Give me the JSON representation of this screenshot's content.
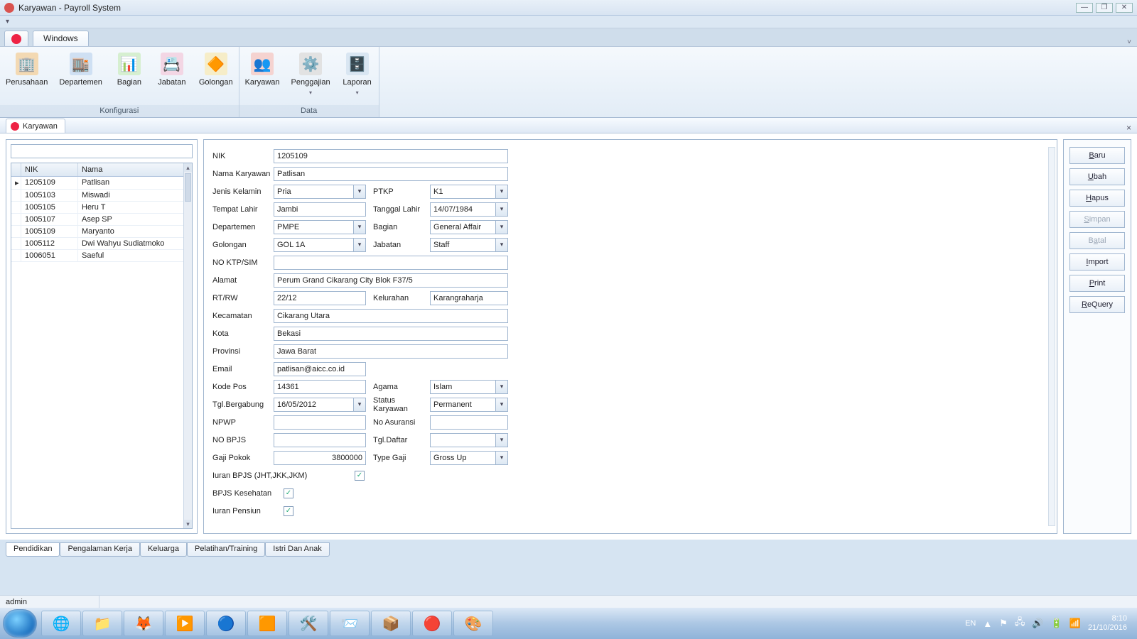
{
  "window": {
    "title": "Karyawan - Payroll System"
  },
  "ribbon": {
    "tab": "Windows",
    "groups": [
      {
        "label": "Konfigurasi",
        "items": [
          {
            "key": "perusahaan",
            "label": "Perusahaan",
            "color": "#e8a23c"
          },
          {
            "key": "departemen",
            "label": "Departemen",
            "color": "#4a7ec8"
          },
          {
            "key": "bagian",
            "label": "Bagian",
            "color": "#6bbf59"
          },
          {
            "key": "jabatan",
            "label": "Jabatan",
            "color": "#d65a9a"
          },
          {
            "key": "golongan",
            "label": "Golongan",
            "color": "#f0c23a"
          }
        ]
      },
      {
        "label": "Data",
        "items": [
          {
            "key": "karyawan",
            "label": "Karyawan",
            "color": "#d9534f"
          },
          {
            "key": "penggajian",
            "label": "Penggajian",
            "color": "#8a8a8a",
            "drop": true
          },
          {
            "key": "laporan",
            "label": "Laporan",
            "color": "#7aa0c4",
            "drop": true
          }
        ]
      }
    ]
  },
  "docTab": {
    "label": "Karyawan"
  },
  "grid": {
    "headers": {
      "nik": "NIK",
      "nama": "Nama"
    },
    "rows": [
      {
        "nik": "1205109",
        "nama": "Patlisan",
        "sel": true
      },
      {
        "nik": "1005103",
        "nama": "Miswadi"
      },
      {
        "nik": "1005105",
        "nama": "Heru T"
      },
      {
        "nik": "1005107",
        "nama": "Asep SP"
      },
      {
        "nik": "1005109",
        "nama": "Maryanto"
      },
      {
        "nik": "1005112",
        "nama": "Dwi Wahyu Sudiatmoko"
      },
      {
        "nik": "1006051",
        "nama": "Saeful"
      }
    ]
  },
  "form": {
    "nik_l": "NIK",
    "nik": "1205109",
    "nama_l": "Nama Karyawan",
    "nama": "Patlisan",
    "jk_l": "Jenis Kelamin",
    "jk": "Pria",
    "ptkp_l": "PTKP",
    "ptkp": "K1",
    "tmp_l": "Tempat Lahir",
    "tmp": "Jambi",
    "tgl_l": "Tanggal Lahir",
    "tgl": "14/07/1984",
    "dep_l": "Departemen",
    "dep": "PMPE",
    "bag_l": "Bagian",
    "bag": "General Affair",
    "gol_l": "Golongan",
    "gol": "GOL 1A",
    "jab_l": "Jabatan",
    "jab": "Staff",
    "ktp_l": "NO KTP/SIM",
    "ktp": "",
    "alm_l": "Alamat",
    "alm": "Perum Grand Cikarang City Blok F37/5",
    "rt_l": "RT/RW",
    "rt": "22/12",
    "kel_l": "Kelurahan",
    "kel": "Karangraharja",
    "kec_l": "Kecamatan",
    "kec": "Cikarang Utara",
    "kota_l": "Kota",
    "kota": "Bekasi",
    "prov_l": "Provinsi",
    "prov": "Jawa Barat",
    "email_l": "Email",
    "email": "patlisan@aicc.co.id",
    "pos_l": "Kode Pos",
    "pos": "14361",
    "agm_l": "Agama",
    "agm": "Islam",
    "tgb_l": "Tgl.Bergabung",
    "tgb": "16/05/2012",
    "stk_l": "Status Karyawan",
    "stk": "Permanent",
    "npwp_l": "NPWP",
    "npwp": "",
    "asr_l": "No Asuransi",
    "asr": "",
    "bpjs_l": "NO BPJS",
    "bpjs": "",
    "tgd_l": "Tgl.Daftar",
    "tgd": "",
    "gaji_l": "Gaji Pokok",
    "gaji": "3800000",
    "tgaji_l": "Type Gaji",
    "tgaji": "Gross Up",
    "iuran_bpjs_l": "Iuran BPJS (JHT,JKK,JKM)",
    "bpjs_kes_l": "BPJS Kesehatan",
    "iuran_pen_l": "Iuran Pensiun"
  },
  "sideButtons": {
    "baru": "Baru",
    "ubah": "Ubah",
    "hapus": "Hapus",
    "simpan": "Simpan",
    "batal": "Batal",
    "import": "Import",
    "print": "Print",
    "requery": "ReQuery"
  },
  "bottomTabs": [
    "Pendidikan",
    "Pengalaman Kerja",
    "Keluarga",
    "Pelatihan/Training",
    "Istri Dan Anak"
  ],
  "status": {
    "user": "admin"
  },
  "taskbar": {
    "lang": "EN",
    "time": "8:10",
    "date": "21/10/2016"
  }
}
